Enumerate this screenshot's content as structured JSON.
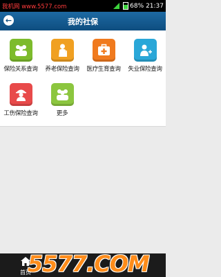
{
  "status_bar": {
    "site_text": "我机网 www.5577.com",
    "battery": "68%",
    "time": "21:37"
  },
  "header": {
    "title": "我的社保"
  },
  "tiles": [
    {
      "label": "保险关系查询",
      "color": "#7dbb2c",
      "icon": "people-icon"
    },
    {
      "label": "养老保险查询",
      "color": "#f0a022",
      "icon": "elder-icon"
    },
    {
      "label": "医疗生育查询",
      "color": "#f07a1e",
      "icon": "medical-kit-icon"
    },
    {
      "label": "失业保险查询",
      "color": "#2aa7d8",
      "icon": "person-cross-icon"
    },
    {
      "label": "工伤保险查询",
      "color": "#e84a4a",
      "icon": "worker-icon"
    },
    {
      "label": "更多",
      "color": "#8cc63f",
      "icon": "more-people-icon"
    }
  ],
  "bottom": {
    "home_label": "首页"
  },
  "watermark": "5577.COM"
}
